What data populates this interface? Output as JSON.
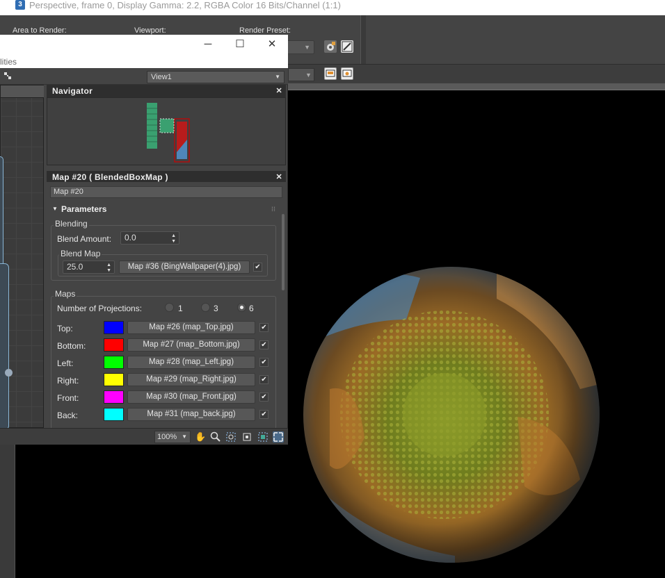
{
  "render_frame": {
    "title": "Perspective, frame 0, Display Gamma: 2.2, RGBA Color 16 Bits/Channel (1:1)",
    "app_icon_label": "3",
    "labels": {
      "area_to_render": "Area to Render:",
      "viewport": "Viewport:",
      "render_preset": "Render Preset:"
    }
  },
  "slate_editor": {
    "menu_fragment": "lities",
    "view_select": "View1",
    "navigator": {
      "title": "Navigator"
    },
    "map_panel": {
      "title": "Map #20  ( BlendedBoxMap )",
      "name_field": "Map #20",
      "rollout_title": "Parameters",
      "blending": {
        "group_label": "Blending",
        "blend_amount_label": "Blend Amount:",
        "blend_amount_value": "0.0",
        "blend_map_label": "Blend Map",
        "blend_map_value": "25.0",
        "blend_map_button": "Map #36 (BingWallpaper(4).jpg)",
        "blend_map_checked": true
      },
      "maps": {
        "group_label": "Maps",
        "projections_label": "Number of Projections:",
        "projection_options": [
          "1",
          "3",
          "6"
        ],
        "projection_selected": "6",
        "rows": [
          {
            "label": "Top:",
            "color": "#0000ff",
            "map": "Map #26 (map_Top.jpg)",
            "checked": true
          },
          {
            "label": "Bottom:",
            "color": "#ff0000",
            "map": "Map #27 (map_Bottom.jpg)",
            "checked": true
          },
          {
            "label": "Left:",
            "color": "#00ff00",
            "map": "Map #28 (map_Left.jpg)",
            "checked": true
          },
          {
            "label": "Right:",
            "color": "#ffff00",
            "map": "Map #29 (map_Right.jpg)",
            "checked": true
          },
          {
            "label": "Front:",
            "color": "#ff00ff",
            "map": "Map #30 (map_Front.jpg)",
            "checked": true
          },
          {
            "label": "Back:",
            "color": "#00ffff",
            "map": "Map #31 (map_back.jpg)",
            "checked": true
          }
        ]
      }
    },
    "status": {
      "zoom": "100%"
    }
  }
}
